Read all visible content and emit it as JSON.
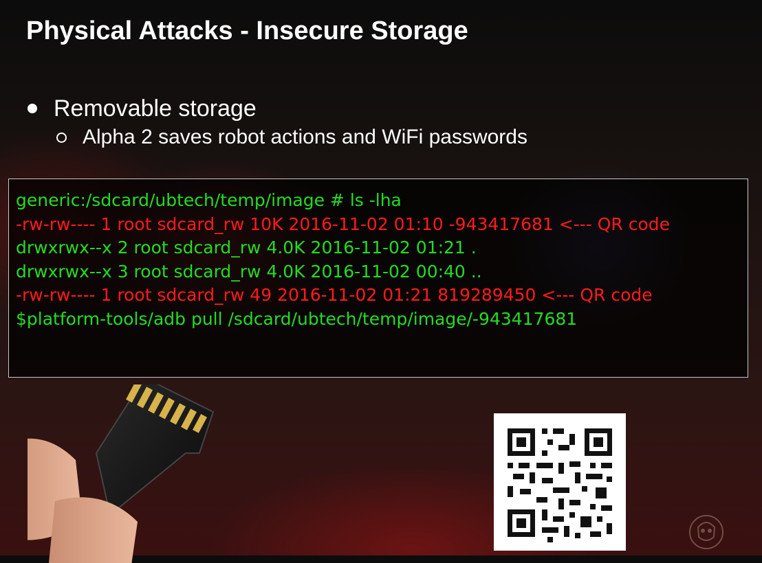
{
  "slide": {
    "title": "Physical Attacks - Insecure Storage"
  },
  "bullets": {
    "level1": "Removable storage",
    "level2": "Alpha 2 saves robot actions and WiFi passwords"
  },
  "terminal": {
    "lines": [
      {
        "text": "generic:/sdcard/ubtech/temp/image # ls -lha",
        "color": "#22dd22"
      },
      {
        "text": "-rw-rw---- 1 root sdcard_rw 10K 2016-11-02 01:10 -943417681 <--- QR code",
        "color": "#ff1a1a"
      },
      {
        "text": "drwxrwx--x 2 root sdcard_rw 4.0K 2016-11-02 01:21 .",
        "color": "#22dd22"
      },
      {
        "text": "drwxrwx--x 3 root sdcard_rw 4.0K 2016-11-02 00:40 ..",
        "color": "#22dd22"
      },
      {
        "text": "-rw-rw---- 1 root sdcard_rw 49 2016-11-02 01:21 819289450 <--- QR code",
        "color": "#ff1a1a"
      },
      {
        "text": "$platform-tools/adb pull /sdcard/ubtech/temp/image/-943417681",
        "color": "#22dd22"
      }
    ]
  },
  "images": {
    "sd_card_icon": "sd-card-icon",
    "qr_code_icon": "qr-code-icon",
    "logo_icon": "skull-logo-icon"
  }
}
